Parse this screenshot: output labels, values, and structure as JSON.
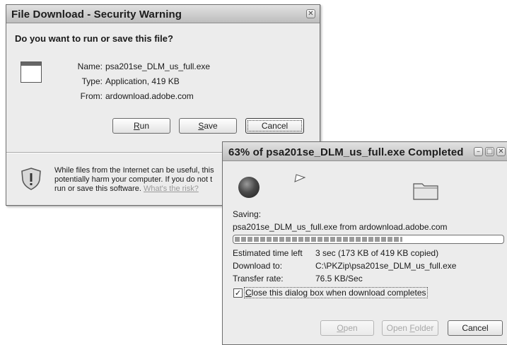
{
  "security_dialog": {
    "title": "File Download - Security Warning",
    "close_glyph": "✕",
    "question": "Do you want to run or save this file?",
    "file_icon": "application-window-icon",
    "fields": [
      {
        "key": "Name:",
        "value": "psa201se_DLM_us_full.exe"
      },
      {
        "key": "Type:",
        "value": "Application, 419 KB"
      },
      {
        "key": "From:",
        "value": "ardownload.adobe.com"
      }
    ],
    "buttons": {
      "run": {
        "prefix": "",
        "hotkey": "R",
        "rest": "un"
      },
      "save": {
        "prefix": "",
        "hotkey": "S",
        "rest": "ave"
      },
      "cancel": "Cancel"
    },
    "warning_icon": "shield-warning-icon",
    "warning_line1": "While files from the Internet can be useful, this",
    "warning_line2": "potentially harm your computer. If you do not t",
    "warning_line3_prefix": "run or save this software.",
    "warning_link": "What's the risk?"
  },
  "progress_dialog": {
    "title": "63% of psa201se_DLM_us_full.exe Completed",
    "progress_percent": 63,
    "saving_label": "Saving:",
    "saving_value": "psa201se_DLM_us_full.exe from ardownload.adobe.com",
    "details": [
      {
        "key": "Estimated time left",
        "value": "3 sec (173 KB of 419 KB copied)"
      },
      {
        "key": "Download to:",
        "value": "C:\\PKZip\\psa201se_DLM_us_full.exe"
      },
      {
        "key": "Transfer rate:",
        "value": "76.5 KB/Sec"
      }
    ],
    "checkbox": {
      "checked": true,
      "check_glyph": "✓",
      "hotkey": "C",
      "rest": "lose this dialog box when download completes"
    },
    "buttons": {
      "open": {
        "hotkey": "O",
        "rest": "pen"
      },
      "open_folder": {
        "prefix": "Open ",
        "hotkey": "F",
        "rest": "older"
      },
      "cancel": "Cancel"
    },
    "icons": [
      "globe-icon",
      "flying-paper-icon",
      "folder-icon"
    ],
    "colors": {
      "progress_fill": "#9a9a9a",
      "title_bar": "#cfcfcf"
    }
  }
}
